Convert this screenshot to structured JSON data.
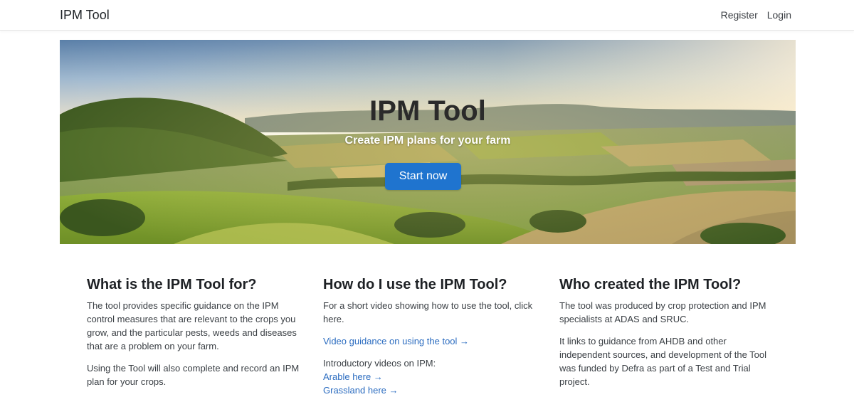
{
  "navbar": {
    "brand": "IPM Tool",
    "register": "Register",
    "login": "Login"
  },
  "hero": {
    "title": "IPM Tool",
    "subtitle": "Create IPM plans for your farm",
    "button": "Start now"
  },
  "columns": [
    {
      "heading": "What is the IPM Tool for?",
      "paragraphs": [
        "The tool provides specific guidance on the IPM control measures that are relevant to the crops you grow, and the particular pests, weeds and diseases that are a problem on your farm.",
        "Using the Tool will also complete and record an IPM plan for your crops."
      ]
    },
    {
      "heading": "How do I use the IPM Tool?",
      "intro": "For a short video showing how to use the tool, click here.",
      "video_link": "Video guidance on using the tool →",
      "intro_videos_label": "Introductory videos on IPM:",
      "arable_link": "Arable here →",
      "grassland_link": "Grassland here →"
    },
    {
      "heading": "Who created the IPM Tool?",
      "paragraphs": [
        "The tool was produced by crop protection and IPM specialists at ADAS and SRUC.",
        "It links to guidance from AHDB and other independent sources, and development of the Tool was funded by Defra as part of a Test and Trial project."
      ]
    }
  ],
  "colors": {
    "primary_button": "#1f74cf",
    "link": "#2b6cc0",
    "text": "#212529"
  }
}
